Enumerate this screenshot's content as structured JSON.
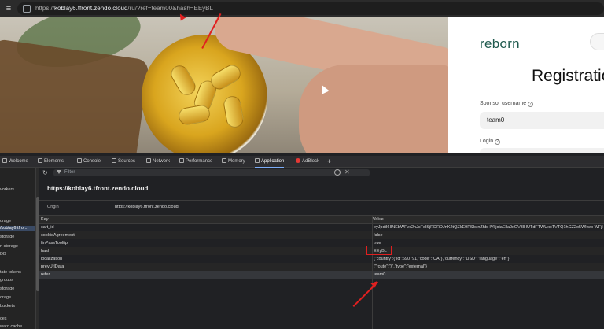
{
  "browser": {
    "url_prefix": "https://",
    "url_host": "koblay6.tfront.zendo.cloud",
    "url_rest": "/ru/?ref=team00&hash=EEyBL"
  },
  "page": {
    "logo": "reborn",
    "title": "Registratio",
    "sponsor_label": "Sponsor username",
    "sponsor_value": "team0",
    "login_label": "Login"
  },
  "devtools": {
    "tabs": [
      {
        "label": "Welcome",
        "icon": "welcome-icon"
      },
      {
        "label": "Elements",
        "icon": "elements-icon"
      },
      {
        "label": "Console",
        "icon": "console-icon"
      },
      {
        "label": "Sources",
        "icon": "sources-icon"
      },
      {
        "label": "Network",
        "icon": "network-icon"
      },
      {
        "label": "Performance",
        "icon": "performance-icon"
      },
      {
        "label": "Memory",
        "icon": "memory-icon"
      },
      {
        "label": "Application",
        "icon": "application-icon"
      },
      {
        "label": "AdBlock",
        "icon": "adblock-icon"
      },
      {
        "label": "+",
        "icon": "plus-icon"
      }
    ],
    "active_tab": "Application",
    "left_panel": [
      "vorkers",
      "orage",
      "/koblay6.tfro...",
      "storage",
      "n storage",
      "DB",
      "tate tokens",
      "groups",
      "storage",
      "orage",
      "buckets",
      "ces",
      "ward cache"
    ],
    "filter_placeholder": "Filter",
    "origin_title": "https://koblay6.tfront.zendo.cloud",
    "origin_label": "Origin",
    "origin_value": "https://koblay6.tfront.zendo.cloud",
    "table": {
      "key_header": "Key",
      "value_header": "Value",
      "rows": [
        {
          "key": "cart_id",
          "value": "eyJpdiI6IlNEbWFvc2hJcTdlSjRDRDJnK2tQZkE9PSIsInZhbHVlIjoiaElla0xGV3lHUTdFTWUxcTVTQ1hCZ2o5Wkwb WFjlu"
        },
        {
          "key": "cookieAgreement",
          "value": "false"
        },
        {
          "key": "finPassTooltip",
          "value": "true"
        },
        {
          "key": "hash",
          "value": "EEyBL"
        },
        {
          "key": "localization",
          "value": "{\"country\":{\"id\":690791,\"code\":\"UA\"},\"currency\":\"USD\",\"language\":\"en\"}"
        },
        {
          "key": "prevUrlData",
          "value": "{\"route\":\"/\",\"type\":\"external\"}"
        },
        {
          "key": "refer",
          "value": "team0"
        }
      ]
    }
  },
  "annotation_color": "#e02020"
}
